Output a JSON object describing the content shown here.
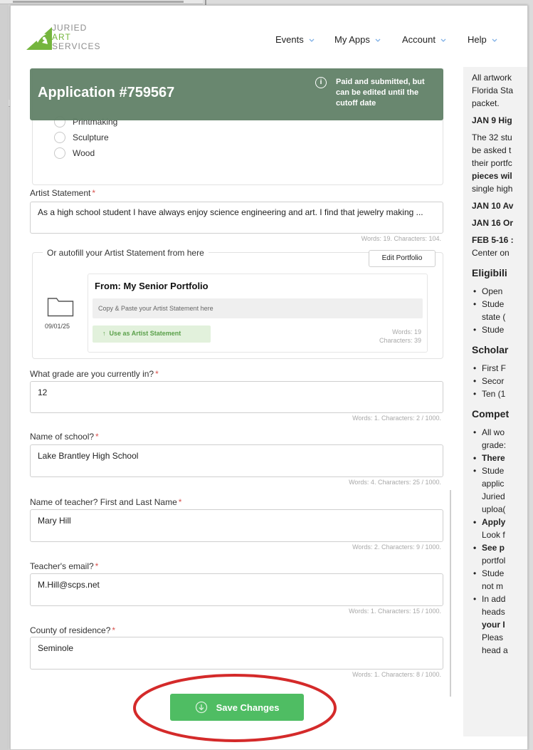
{
  "header": {
    "logo": {
      "line1": "JURIED",
      "line2": "ART",
      "line3": "SERVICES"
    },
    "nav": [
      {
        "label": "Events"
      },
      {
        "label": "My Apps"
      },
      {
        "label": "Account"
      },
      {
        "label": "Help"
      }
    ]
  },
  "banner": {
    "title": "Application #759567",
    "message": "Paid and submitted, but can be edited until the cutoff date"
  },
  "medium_options": [
    "Printmaking",
    "Sculpture",
    "Wood"
  ],
  "form": {
    "artist_statement": {
      "label": "Artist Statement",
      "value": "As a high school student I have always enjoy science engineering and art. I find that jewelry making ...",
      "count": "Words: 19. Characters: 104."
    },
    "autofill": {
      "legend": "Or autofill your Artist Statement from here",
      "edit_button": "Edit Portfolio",
      "folder_date": "09/01/25",
      "card_title": "From: My Senior Portfolio",
      "card_placeholder": "Copy & Paste your Artist Statement here",
      "use_button": "Use as Artist Statement",
      "words": "Words: 19",
      "characters": "Characters: 39"
    },
    "grade": {
      "label": "What grade are you currently in?",
      "value": "12",
      "count": "Words: 1. Characters: 2 / 1000."
    },
    "school": {
      "label": "Name of school?",
      "value": "Lake Brantley High School",
      "count": "Words: 4. Characters: 25 / 1000."
    },
    "teacher": {
      "label": "Name of teacher? First and Last Name",
      "value": "Mary Hill",
      "count": "Words: 2. Characters: 9 / 1000."
    },
    "email": {
      "label": "Teacher's email?",
      "value": "M.Hill@scps.net",
      "count": "Words: 1. Characters: 15 / 1000."
    },
    "county": {
      "label": "County of residence?",
      "value": "Seminole",
      "count": "Words: 1. Characters: 8 / 1000."
    },
    "required_mark": "*",
    "save_button": "Save Changes"
  },
  "sidebar": {
    "intro": [
      "All artwork",
      "Florida Sta",
      "packet."
    ],
    "jan9_title": "JAN 9 Hig",
    "jan9_lines": [
      "The 32 stu",
      "be asked t",
      "their portfc",
      "pieces wil",
      "single high"
    ],
    "jan10": "JAN 10 Av",
    "jan16": "JAN 16 Or",
    "feb": [
      "FEB 5-16 :",
      "Center on"
    ],
    "eligibility_title": "Eligibili",
    "eligibility": [
      "Open",
      "Stude",
      "state (",
      "Stude"
    ],
    "scholarships_title": "Scholar",
    "scholarships": [
      "First F",
      "Secor",
      "Ten (1"
    ],
    "competition_title": "Compet",
    "competition": [
      "All wo",
      "grade:",
      "There",
      "Stude",
      "applic",
      "Juried",
      "uploa(",
      "Apply",
      "Look f",
      "See p",
      "portfol",
      "Stude",
      "not m",
      "In add",
      "heads",
      "your I",
      "Pleas",
      "head a"
    ]
  },
  "colors": {
    "brand_green": "#74b53d",
    "banner_bg": "#5f8066",
    "save_button": "#4fbd63",
    "annotation_red": "#d42a2a",
    "required": "#d9534f"
  }
}
